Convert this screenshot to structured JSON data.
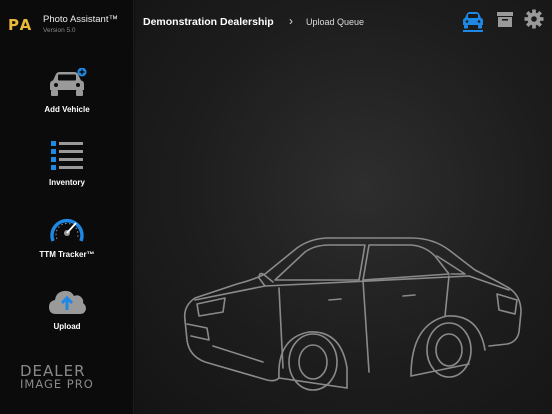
{
  "app": {
    "logo_text": "PA",
    "name": "Photo Assistant™",
    "version": "Version 5.0"
  },
  "sidebar": {
    "items": [
      {
        "label": "Add Vehicle",
        "icon": "add-vehicle-icon"
      },
      {
        "label": "Inventory",
        "icon": "inventory-list-icon"
      },
      {
        "label": "TTM Tracker™",
        "icon": "speedometer-icon"
      },
      {
        "label": "Upload",
        "icon": "cloud-upload-icon"
      }
    ],
    "footer_logo": {
      "line1": "DEALER",
      "line2": "IMAGE PRO"
    }
  },
  "header": {
    "breadcrumb": {
      "dealer": "Demonstration Dealership",
      "page": "Upload Queue"
    },
    "icons": [
      "car-icon",
      "archive-icon",
      "gear-icon"
    ],
    "active_icon": "car-icon"
  },
  "colors": {
    "accent": "#1e88e5",
    "brand_gold": "#e8b93a",
    "sidebar_bg": "#0b0b0b",
    "icon_gray": "#9a9a9a"
  }
}
